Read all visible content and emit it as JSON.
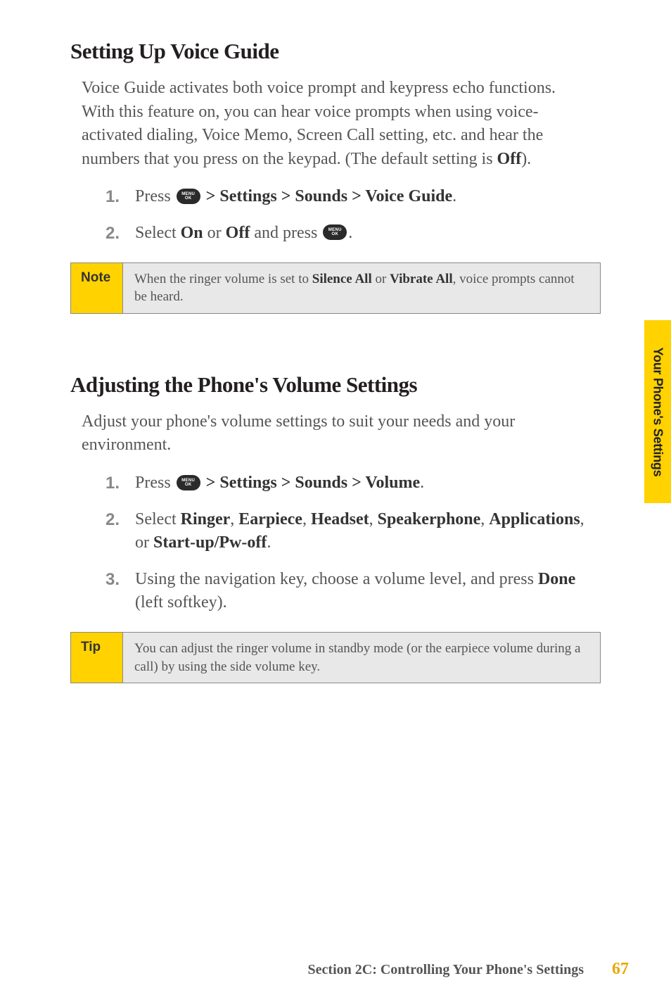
{
  "section1": {
    "title": "Setting Up Voice Guide",
    "intro_part1": "Voice Guide activates both voice prompt and keypress echo functions. With this feature on, you can hear voice prompts when using voice-activated dialing, Voice Memo, Screen Call setting, etc. and hear the numbers that you press on the keypad. (The default setting is ",
    "intro_off": "Off",
    "intro_part2": ").",
    "steps": [
      {
        "num": "1.",
        "prefix": "Press ",
        "bold": " > Settings > Sounds > Voice Guide",
        "suffix": "."
      },
      {
        "num": "2.",
        "prefix": "Select ",
        "bold1": "On",
        "mid": " or ",
        "bold2": "Off",
        "mid2": " and press ",
        "suffix": "."
      }
    ]
  },
  "note": {
    "label": "Note",
    "text_part1": "When the ringer volume is set to ",
    "bold1": "Silence All",
    "mid": " or ",
    "bold2": "Vibrate All",
    "text_part2": ", voice prompts cannot be heard."
  },
  "section2": {
    "title": "Adjusting the Phone's Volume Settings",
    "intro": "Adjust your phone's volume settings to suit your needs and your environment.",
    "steps": {
      "s1": {
        "num": "1.",
        "prefix": "Press ",
        "bold": " > Settings > Sounds > Volume",
        "suffix": "."
      },
      "s2": {
        "num": "2.",
        "prefix": "Select ",
        "b1": "Ringer",
        "c1": ", ",
        "b2": "Earpiece",
        "c2": ", ",
        "b3": "Headset",
        "c3": ", ",
        "b4": "Speakerphone",
        "c4": ", ",
        "b5": "Applications",
        "c5": ", or ",
        "b6": "Start-up/Pw-off",
        "suffix": "."
      },
      "s3": {
        "num": "3.",
        "prefix": "Using the navigation key, choose a volume level, and press ",
        "bold": "Done",
        "suffix": " (left softkey)."
      }
    }
  },
  "tip": {
    "label": "Tip",
    "text": "You can adjust the ringer volume in standby mode (or the earpiece volume during a call) by using the side volume key."
  },
  "sidebar": {
    "label": "Your Phone's Settings"
  },
  "footer": {
    "section": "Section 2C: Controlling Your Phone's Settings",
    "page": "67"
  }
}
